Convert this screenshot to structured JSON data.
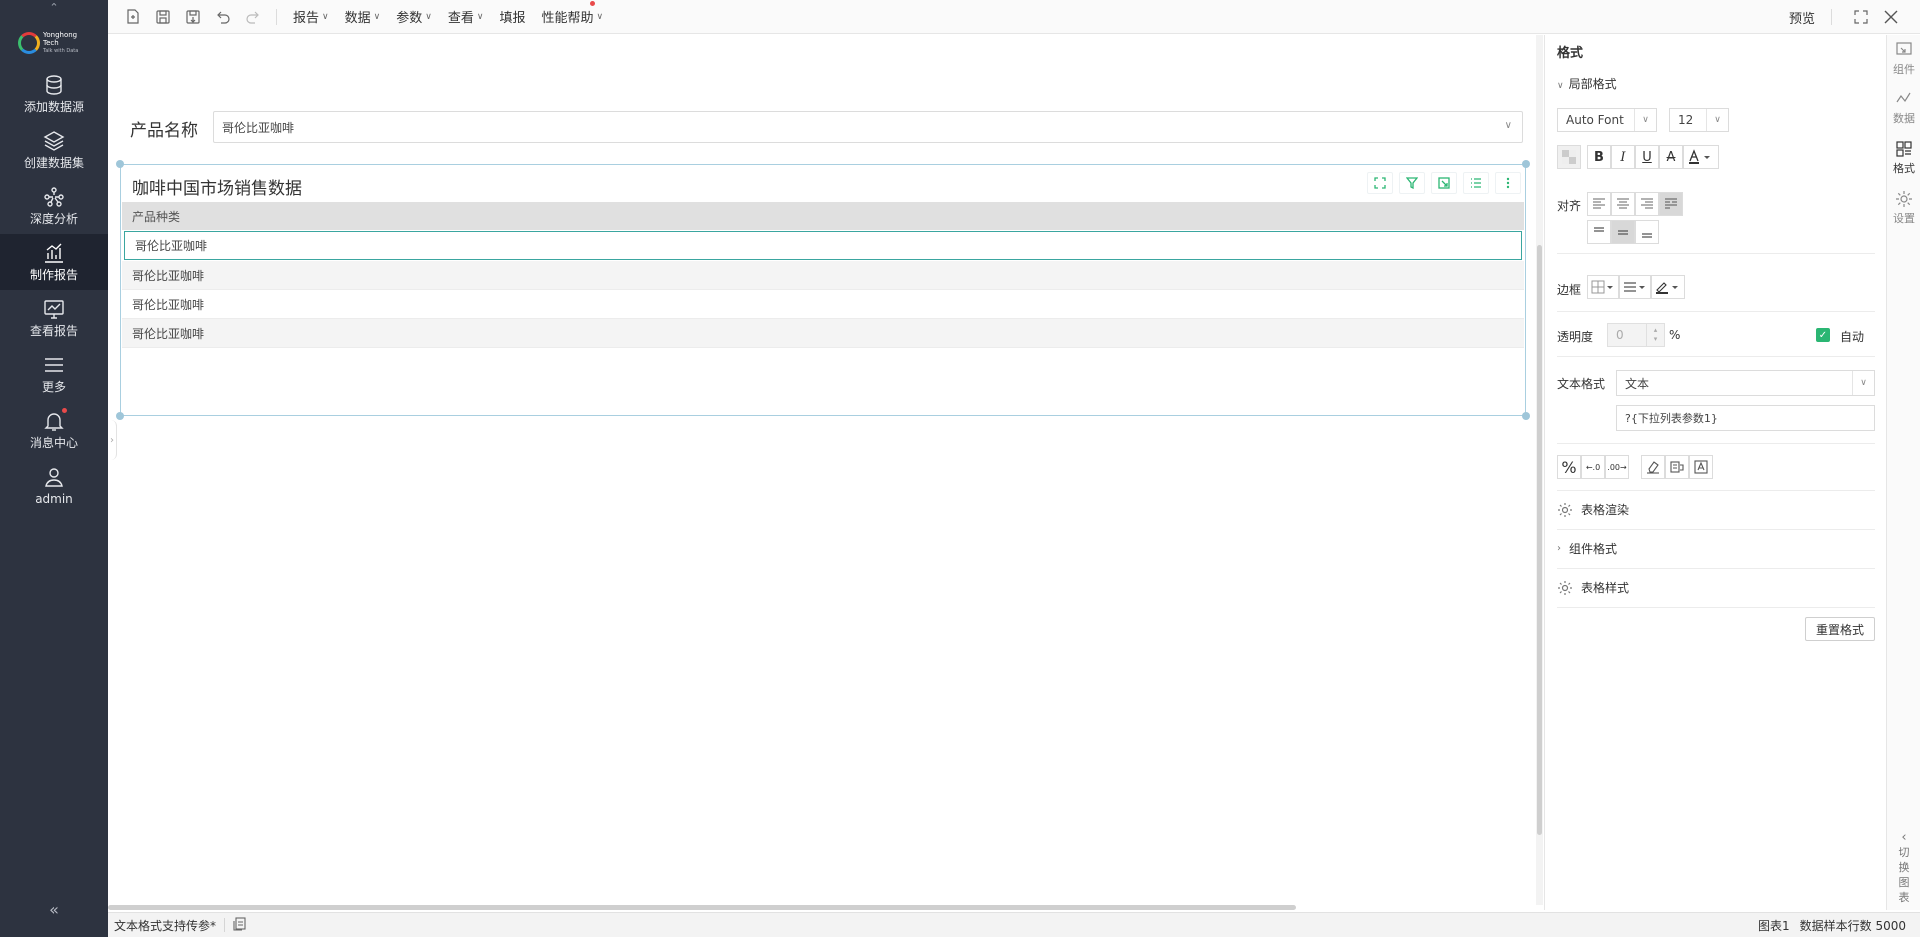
{
  "sidebar": {
    "logo": {
      "name": "Yonghong Tech",
      "tagline": "Talk with Data"
    },
    "items": [
      {
        "label": "添加数据源",
        "icon": "database-icon"
      },
      {
        "label": "创建数据集",
        "icon": "layers-icon"
      },
      {
        "label": "深度分析",
        "icon": "network-icon"
      },
      {
        "label": "制作报告",
        "icon": "bar-chart-icon",
        "active": true
      },
      {
        "label": "查看报告",
        "icon": "monitor-chart-icon"
      },
      {
        "label": "更多",
        "icon": "menu-icon"
      },
      {
        "label": "消息中心",
        "icon": "bell-icon",
        "badge": true
      },
      {
        "label": "admin",
        "icon": "user-icon"
      }
    ],
    "collapse_icon": "double-chevron-left-icon"
  },
  "toolbar": {
    "icons": [
      "new-report-icon",
      "save-icon",
      "save-as-icon",
      "undo-icon",
      "redo-icon"
    ],
    "menus": [
      {
        "label": "报告",
        "dropdown": true
      },
      {
        "label": "数据",
        "dropdown": true
      },
      {
        "label": "参数",
        "dropdown": true
      },
      {
        "label": "查看",
        "dropdown": true
      },
      {
        "label": "填报",
        "dropdown": false
      },
      {
        "label": "性能帮助",
        "dropdown": true,
        "badge": true
      }
    ],
    "preview_label": "预览",
    "fullscreen_icon": "fullscreen-icon",
    "close_icon": "close-icon"
  },
  "canvas": {
    "param": {
      "label": "产品名称",
      "value": "哥伦比亚咖啡"
    },
    "table": {
      "title": "咖啡中国市场销售数据",
      "tools": [
        "expand-icon",
        "filter-icon",
        "export-icon",
        "list-icon",
        "more-vertical-icon"
      ],
      "columns": [
        "产品种类"
      ],
      "rows": [
        "哥伦比亚咖啡",
        "哥伦比亚咖啡",
        "哥伦比亚咖啡",
        "哥伦比亚咖啡"
      ]
    }
  },
  "format_panel": {
    "title": "格式",
    "section_local": "局部格式",
    "font_family": "Auto Font",
    "font_size": "12",
    "style_buttons": [
      "B",
      "I",
      "U",
      "A"
    ],
    "align_label": "对齐",
    "border_label": "边框",
    "opacity_label": "透明度",
    "opacity_value": "0",
    "opacity_unit": "%",
    "auto_label": "自动",
    "auto_checked": true,
    "text_format_label": "文本格式",
    "text_format_value": "文本",
    "text_format_expr": "?{下拉列表参数1}",
    "table_render": "表格渲染",
    "component_format": "组件格式",
    "table_style": "表格样式",
    "reset_button": "重置格式"
  },
  "rail": {
    "items": [
      {
        "label": "组件",
        "icon": "component-icon"
      },
      {
        "label": "数据",
        "icon": "data-icon"
      },
      {
        "label": "格式",
        "icon": "format-icon",
        "active": true
      },
      {
        "label": "设置",
        "icon": "settings-icon"
      }
    ],
    "switch_label": [
      "切",
      "换",
      "图",
      "表"
    ]
  },
  "status": {
    "tab_label": "文本格式支持传参*",
    "component": "图表1",
    "sample_rows_label": "数据样本行数 5000"
  },
  "colors": {
    "sidebar_bg": "#2d3340",
    "accent_green": "#2bb673",
    "selection_teal": "#3aa6a0"
  }
}
